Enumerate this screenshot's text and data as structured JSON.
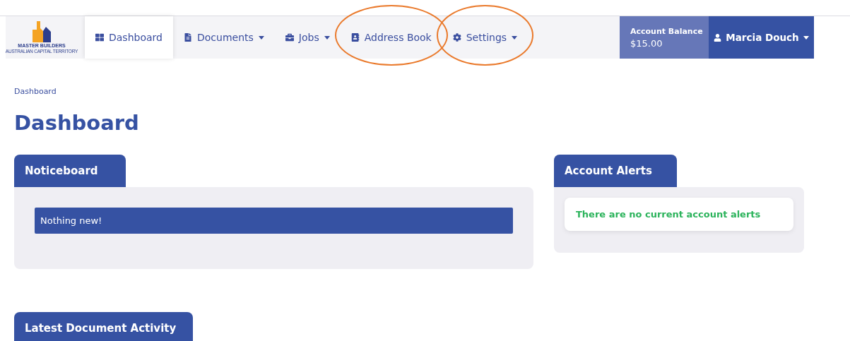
{
  "logo": {
    "name": "MASTER BUILDERS",
    "region": "AUSTRALIAN CAPITAL TERRITORY"
  },
  "nav": [
    {
      "label": "Dashboard",
      "kind": "grid",
      "dropdown": false,
      "selected": true,
      "highlighted": false
    },
    {
      "label": "Documents",
      "kind": "file",
      "dropdown": true,
      "selected": false,
      "highlighted": false
    },
    {
      "label": "Jobs",
      "kind": "briefcase",
      "dropdown": true,
      "selected": false,
      "highlighted": false
    },
    {
      "label": "Address Book",
      "kind": "book",
      "dropdown": false,
      "selected": false,
      "highlighted": true
    },
    {
      "label": "Settings",
      "kind": "gear",
      "dropdown": true,
      "selected": false,
      "highlighted": true
    }
  ],
  "account_balance": {
    "label": "Account Balance",
    "value": "$15.00"
  },
  "user": {
    "name": "Marcia Douch"
  },
  "breadcrumb": "Dashboard",
  "title": "Dashboard",
  "noticeboard": {
    "title": "Noticeboard",
    "message": "Nothing new!"
  },
  "account_alerts": {
    "title": "Account Alerts",
    "message": "There are no current account alerts"
  },
  "latest_activity": {
    "title": "Latest Document Activity"
  }
}
